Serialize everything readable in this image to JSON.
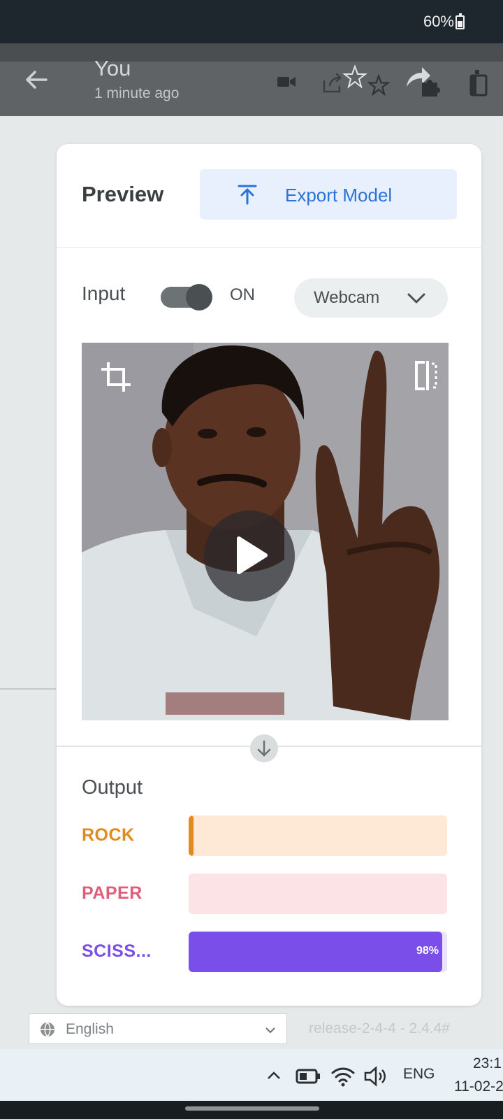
{
  "status_bar": {
    "battery_percent": "60%"
  },
  "player": {
    "author": "You",
    "time_ago": "1 minute ago",
    "icons": [
      "back-icon",
      "video-camera-icon",
      "share-icon",
      "star-icon",
      "star-outline-icon",
      "forward-icon",
      "puzzle-icon",
      "sidebar-icon"
    ]
  },
  "preview": {
    "title": "Preview",
    "export_label": "Export Model",
    "input_label": "Input",
    "toggle_state": "ON",
    "source": "Webcam",
    "output_label": "Output",
    "classes": [
      {
        "name": "ROCK",
        "confidence": 0.01,
        "label": "",
        "color": "#e38a1f",
        "track": "#fde9d6"
      },
      {
        "name": "PAPER",
        "confidence": 0.0,
        "label": "",
        "color": "#e05d7c",
        "track": "#fbe3e6"
      },
      {
        "name": "SCISS...",
        "confidence": 0.98,
        "label": "98%",
        "color": "#7a4ee8",
        "track": "#ece4fc"
      }
    ]
  },
  "footer": {
    "language": "English",
    "release": "release-2-4-4 - 2.4.4#"
  },
  "taskbar": {
    "lang": "ENG",
    "time": "23:1",
    "date": "11-02-2"
  },
  "colors": {
    "accent": "#2a73d8",
    "status_bar": "#1e272d",
    "player_header": "#5f6365"
  }
}
